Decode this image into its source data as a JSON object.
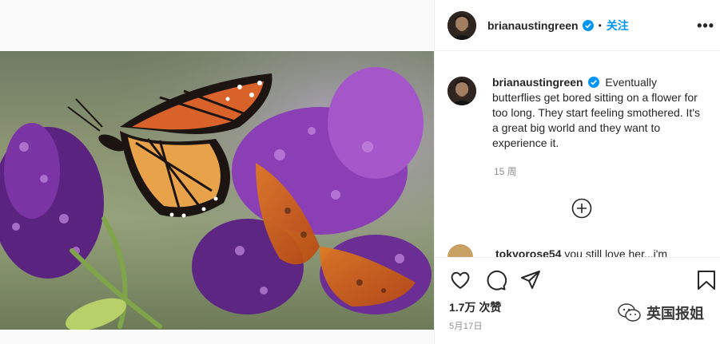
{
  "post": {
    "username": "brianaustingreen",
    "follow_label": "关注",
    "dot": "•",
    "more_label": "•••",
    "caption": "Eventually butterflies get bored sitting on a flower for too long. They start feeling smothered. It's a great big world and they want to experience it.",
    "time_ago": "15 周",
    "partial_comment": {
      "username": "tokyorose54",
      "text": "you still love her...i'm"
    },
    "likes": "1.7万 次赞",
    "date": "5月17日"
  },
  "icons": [
    "verified-badge-icon",
    "more-options-icon",
    "load-more-comments-icon",
    "heart-icon",
    "comment-icon",
    "share-icon",
    "bookmark-icon",
    "wechat-icon"
  ],
  "watermark": {
    "text": "英国报姐"
  },
  "colors": {
    "accent": "#0095f6",
    "text": "#262626",
    "muted": "#8e8e8e",
    "border": "#efefef"
  }
}
